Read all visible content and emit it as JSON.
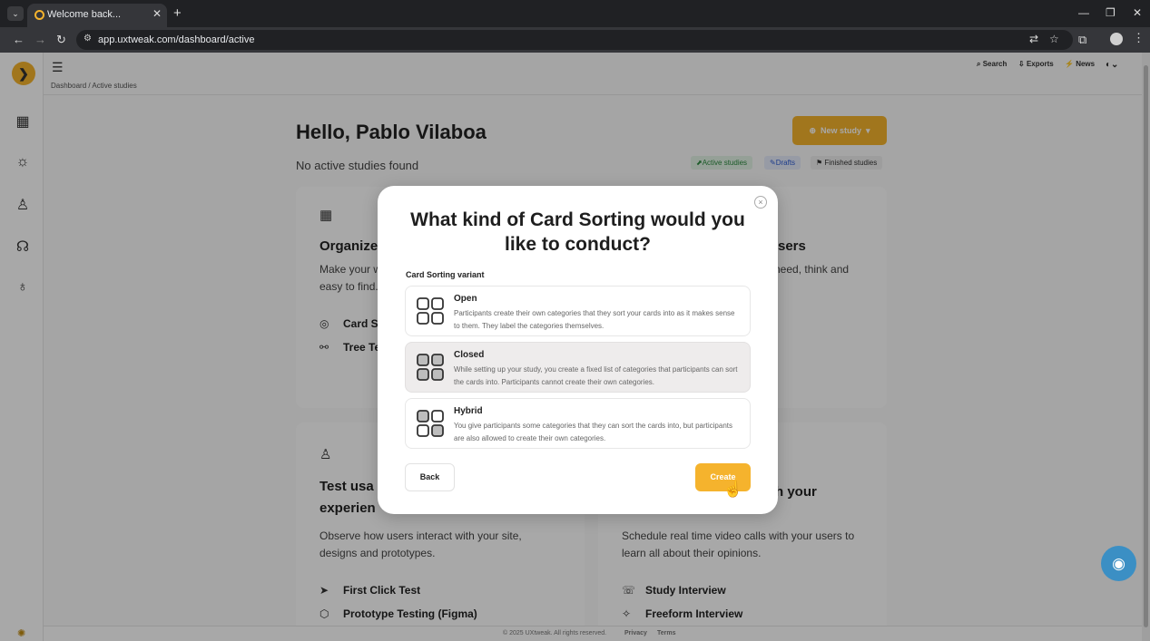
{
  "browser": {
    "tab_title": "Welcome back...",
    "url": "app.uxtweak.com/dashboard/active"
  },
  "header": {
    "search": "Search",
    "exports": "Exports",
    "news": "News"
  },
  "breadcrumb": "Dashboard / Active studies",
  "main": {
    "greeting": "Hello, Pablo Vilaboa",
    "no_studies": "No active studies found",
    "new_study": "New study",
    "filters": [
      "Active studies",
      "Drafts",
      "Finished studies"
    ]
  },
  "cards": {
    "organize": {
      "title": "Organize",
      "desc_l1": "Make your w",
      "desc_l2": "easy to find.",
      "link1": "Card S",
      "link2": "Tree Te"
    },
    "users": {
      "title": "sers",
      "desc": "need, think and"
    },
    "test": {
      "title_l1": "Test usa",
      "title_l2": "experien",
      "desc_l1": "Observe how users interact with your site,",
      "desc_l2": "designs and prototypes.",
      "link1": "First Click Test",
      "link2": "Prototype Testing (Figma)"
    },
    "talk": {
      "title": "th your",
      "desc_l1": "Schedule real time video calls with your users to",
      "desc_l2": "learn all about their opinions.",
      "link1": "Study Interview",
      "link2": "Freeform Interview"
    }
  },
  "footer": {
    "copyright": "© 2025 UXtweak. All rights reserved.",
    "privacy": "Privacy",
    "terms": "Terms"
  },
  "modal": {
    "title": "What kind of Card Sorting would you like to conduct?",
    "close_glyph": "×",
    "variant_label": "Card Sorting variant",
    "options": [
      {
        "title": "Open",
        "desc": "Participants create their own categories that they sort your cards into as it makes sense to them. They label the categories themselves.",
        "selected": false
      },
      {
        "title": "Closed",
        "desc": "While setting up your study, you create a fixed list of categories that participants can sort the cards into. Participants cannot create their own categories.",
        "selected": true
      },
      {
        "title": "Hybrid",
        "desc": "You give participants some categories that they can sort the cards into, but participants are also allowed to create their own categories.",
        "selected": false
      }
    ],
    "back": "Back",
    "create": "Create"
  },
  "colors": {
    "accent": "#f5b32d",
    "chat": "#3b8fc4"
  }
}
